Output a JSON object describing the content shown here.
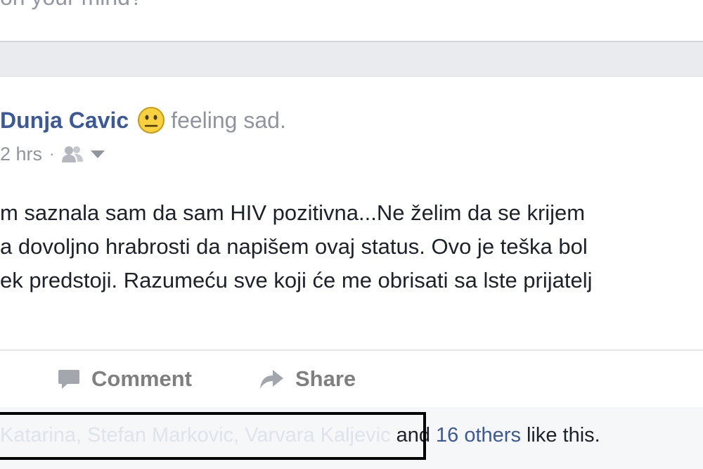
{
  "composer": {
    "prompt": "on your mind?"
  },
  "post": {
    "author": "Dunja Cavic",
    "feeling": "feeling sad.",
    "time": "2 hrs",
    "separator": "·",
    "icons": {
      "feeling": "sad-face-icon",
      "audience": "friends-icon",
      "menu": "chevron-down-icon"
    },
    "body_lines": [
      "m saznala sam da sam HIV pozitivna...Ne želim da se krijem",
      "a dovoljno hrabrosti da napišem ovaj status. Ovo je teška bol",
      "ek predstoji. Razumeću sve koji će me obrisati sa lste prijatelj"
    ]
  },
  "actions": {
    "comment": "Comment",
    "share": "Share"
  },
  "likes": {
    "names": [
      "Katarina",
      "Stefan Markovic",
      "Varvara Kaljevic"
    ],
    "name_separator": ",",
    "and_text": "and",
    "others_text": "16 others",
    "suffix": "like this."
  },
  "colors": {
    "link": "#3b5998",
    "secondary": "#90949c",
    "text": "#1d2129"
  }
}
